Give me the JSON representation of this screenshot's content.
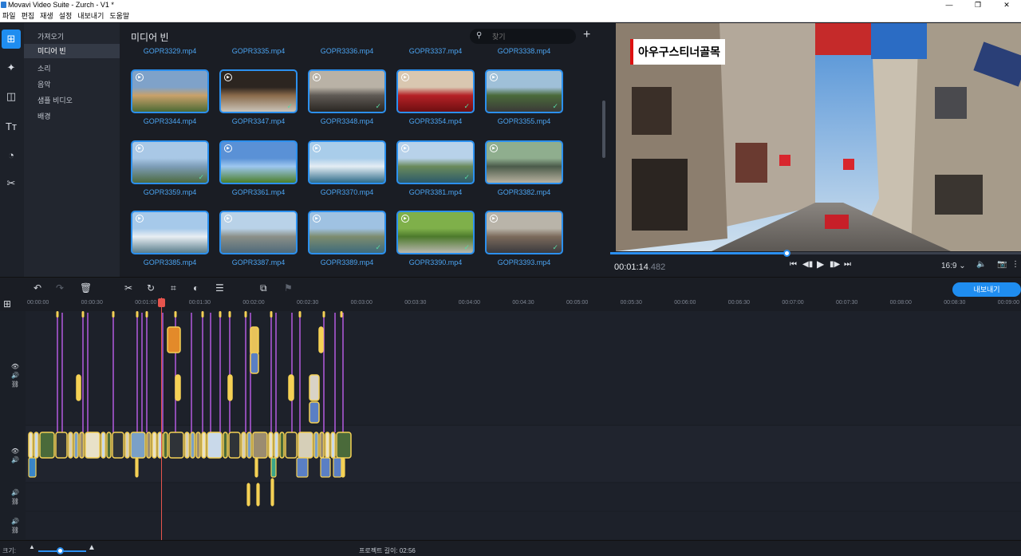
{
  "window": {
    "title": "Movavi Video Suite - Zurch - V1 *",
    "controls": [
      "—",
      "❐",
      "✕"
    ]
  },
  "menu": [
    "파일",
    "편집",
    "재생",
    "설정",
    "내보내기",
    "도움말"
  ],
  "left_tools": [
    {
      "name": "import-media-icon",
      "glyph": "⊞",
      "active": true
    },
    {
      "name": "magic-wand-icon",
      "glyph": "✦",
      "active": false
    },
    {
      "name": "transitions-icon",
      "glyph": "◫",
      "active": false
    },
    {
      "name": "titles-icon",
      "glyph": "Tт",
      "active": false
    },
    {
      "name": "stickers-icon",
      "glyph": "◔",
      "active": false
    },
    {
      "name": "more-tools-icon",
      "glyph": "✂",
      "active": false
    }
  ],
  "categories": [
    {
      "label": "가져오기",
      "active": false
    },
    {
      "label": "미디어 빈",
      "active": true
    },
    {
      "label": "소리",
      "active": false
    },
    {
      "label": "음악",
      "active": false
    },
    {
      "label": "샘플 비디오",
      "active": false
    },
    {
      "label": "배경",
      "active": false
    }
  ],
  "media": {
    "title": "미디어 빈",
    "search_placeholder": "찾기",
    "top_row_names": [
      "GOPR3329.mp4",
      "GOPR3335.mp4",
      "GOPR3336.mp4",
      "GOPR3337.mp4",
      "GOPR3338.mp4"
    ],
    "rows": [
      [
        {
          "name": "GOPR3344.mp4",
          "colors": [
            "#7fa2c9",
            "#c9a16a",
            "#4d6a35"
          ],
          "checked": false
        },
        {
          "name": "GOPR3347.mp4",
          "colors": [
            "#2c2520",
            "#8a6a4a",
            "#c9c3b8"
          ],
          "checked": true
        },
        {
          "name": "GOPR3348.mp4",
          "colors": [
            "#b9b2a6",
            "#5f5a55",
            "#2a2622"
          ],
          "checked": true
        },
        {
          "name": "GOPR3354.mp4",
          "colors": [
            "#d9c7b0",
            "#b52126",
            "#6e0f12"
          ],
          "checked": true
        },
        {
          "name": "GOPR3355.mp4",
          "colors": [
            "#9fc0d8",
            "#4a6a3a",
            "#3b3a38"
          ],
          "checked": true
        }
      ],
      [
        {
          "name": "GOPR3359.mp4",
          "colors": [
            "#a9c8e6",
            "#7d9db8",
            "#4d6a40"
          ],
          "checked": true
        },
        {
          "name": "GOPR3361.mp4",
          "colors": [
            "#5a91d6",
            "#9ec7f0",
            "#4c7f2a"
          ],
          "checked": false
        },
        {
          "name": "GOPR3370.mp4",
          "colors": [
            "#a9cdea",
            "#e4edf4",
            "#2f6c8a"
          ],
          "checked": false
        },
        {
          "name": "GOPR3381.mp4",
          "colors": [
            "#b8d2ea",
            "#6a8a5a",
            "#2c5a6a"
          ],
          "checked": true
        },
        {
          "name": "GOPR3382.mp4",
          "colors": [
            "#8fae8e",
            "#4b5b4a",
            "#b7b19f"
          ],
          "checked": false
        }
      ],
      [
        {
          "name": "GOPR3385.mp4",
          "colors": [
            "#a6c9ea",
            "#e8eef3",
            "#5a7e8c"
          ],
          "checked": false
        },
        {
          "name": "GOPR3387.mp4",
          "colors": [
            "#b9d2e8",
            "#8b8f88",
            "#4e6a7a"
          ],
          "checked": false
        },
        {
          "name": "GOPR3389.mp4",
          "colors": [
            "#9fc2e2",
            "#7d8c6e",
            "#3e6b7b"
          ],
          "checked": true
        },
        {
          "name": "GOPR3390.mp4",
          "colors": [
            "#7fb04a",
            "#4d7a2c",
            "#b8b7ae"
          ],
          "checked": true
        },
        {
          "name": "GOPR3393.mp4",
          "colors": [
            "#b9b4a9",
            "#7b6a5b",
            "#3a3a3e"
          ],
          "checked": true
        }
      ]
    ]
  },
  "preview": {
    "caption": "아우구스티너골목",
    "timecode_main": "00:01:14",
    "timecode_ms": ".482",
    "progress": 0.43,
    "aspect_ratio": "16:9 ⌄",
    "controls": {
      "prev": "⏮",
      "step_back": "◀▮",
      "play": "▶",
      "step_fwd": "▮▶",
      "next": "⏭",
      "volume": "🔈",
      "snapshot": "📷",
      "menu": "⋮"
    }
  },
  "toolbar": {
    "undo": "↶",
    "redo": "↷",
    "delete": "🗑",
    "cut": "✂",
    "rotate": "↻",
    "crop": "⌗",
    "color": "◐",
    "settings": "☰",
    "overlay": "⧉",
    "marker": "⚑",
    "export_label": "내보내기"
  },
  "ruler_ticks": [
    "00:00:00",
    "00:00:30",
    "00:01:00",
    "00:01:30",
    "00:02:00",
    "00:02:30",
    "00:03:00",
    "00:03:30",
    "00:04:00",
    "00:04:30",
    "00:05:00",
    "00:05:30",
    "00:06:00",
    "00:06:30",
    "00:07:00",
    "00:07:30",
    "00:08:00",
    "00:08:30",
    "00:09:00"
  ],
  "status": {
    "zoom_label": "크기:",
    "zoom_level": 0.45,
    "project_length": "프로젝트 길이:  02:56"
  },
  "colors": {
    "accent": "#1f8df0",
    "clip_border": "#f5d155",
    "marker_line": "#b45be0",
    "playhead": "#e6544d"
  }
}
